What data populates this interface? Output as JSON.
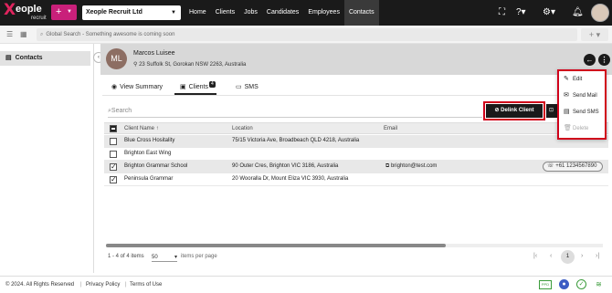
{
  "topbar": {
    "logo_mark": "X",
    "logo_word": "eople",
    "logo_sub": "recruit",
    "add_label": "+",
    "org_name": "Xeople Recruit Ltd",
    "nav": [
      "Home",
      "Clients",
      "Jobs",
      "Candidates",
      "Employees",
      "Contacts"
    ],
    "active_nav": "Contacts",
    "icons": [
      "fullscreen-icon",
      "help-icon",
      "settings-icon",
      "bell-icon",
      "user-avatar"
    ]
  },
  "global_search": {
    "placeholder": "Global Search - Something awesome is coming soon",
    "add_label": "+"
  },
  "sidebar": {
    "items": [
      {
        "label": "Contacts",
        "icon": "document-icon"
      }
    ]
  },
  "contact": {
    "initials": "ML",
    "name": "Marcos Luisee",
    "address": "23 Suffolk St, Gorokan NSW 2263, Australia"
  },
  "tabs": [
    {
      "label": "View Summary",
      "icon": "eye-icon"
    },
    {
      "label": "Clients",
      "icon": "briefcase-icon",
      "badge": "4"
    },
    {
      "label": "SMS",
      "icon": "chat-icon"
    }
  ],
  "table": {
    "search_placeholder": "Search",
    "delink_label": "Delink Client",
    "columns": [
      "Client Name",
      "Location",
      "Email"
    ],
    "sort_indicator": "↑",
    "rows": [
      {
        "name": "Blue Cross Hositality",
        "location": "75/15 Victoria Ave, Broadbeach QLD 4218, Australia",
        "email": "",
        "phone": "",
        "checked": false,
        "selected": true
      },
      {
        "name": "Brighton East Wing",
        "location": "",
        "email": "",
        "phone": "",
        "checked": false,
        "selected": false
      },
      {
        "name": "Brighton Grammar School",
        "location": "90 Outer Cres, Brighton VIC 3186, Australia",
        "email": "brighton@test.com",
        "phone": "+61 1234567890",
        "checked": true,
        "selected": true
      },
      {
        "name": "Peninsula Grammar",
        "location": "20 Wooralla Dr, Mount Eliza VIC 3930, Australia",
        "email": "",
        "phone": "",
        "checked": true,
        "selected": false
      }
    ]
  },
  "pagination": {
    "range_text": "1 - 4 of 4 items",
    "per_page": "50",
    "per_page_label": "items per page",
    "current_page": "1"
  },
  "menu": {
    "items": [
      {
        "label": "Edit",
        "icon": "pencil-icon",
        "disabled": false
      },
      {
        "label": "Send Mail",
        "icon": "mail-icon",
        "disabled": false
      },
      {
        "label": "Send SMS",
        "icon": "sms-icon",
        "disabled": false
      },
      {
        "label": "Delete",
        "icon": "trash-icon",
        "disabled": true
      }
    ]
  },
  "footer": {
    "copyright": "© 2024. All Rights Reserved",
    "privacy": "Privacy Policy",
    "terms": "Terms of Use",
    "ppd_label": "PPD"
  },
  "colors": {
    "accent": "#c9207a",
    "topbar": "#1a1a1a",
    "highlight_border": "#d0021b"
  }
}
